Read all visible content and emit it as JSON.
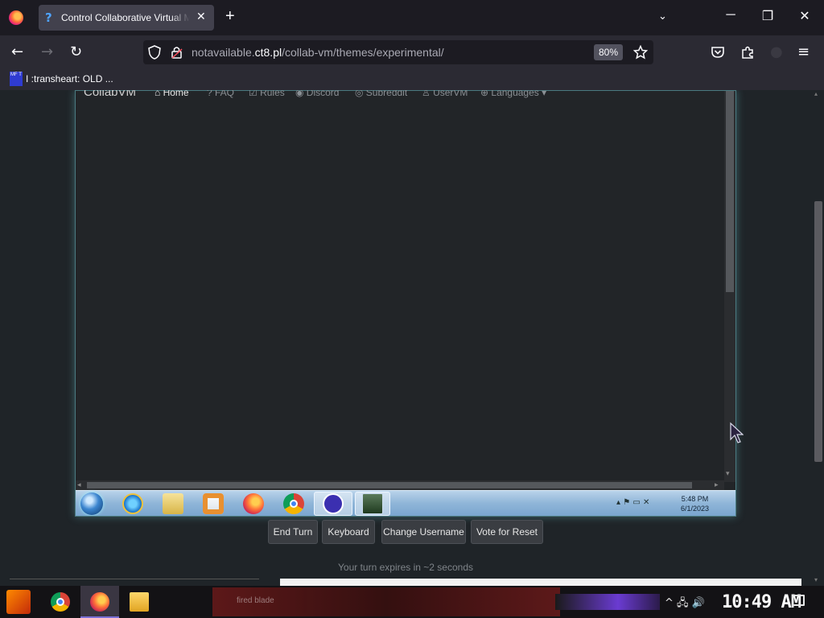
{
  "browser": {
    "tab_title": "Control Collaborative Virtual Machines",
    "tab_favicon": "?",
    "tab_close": "✕",
    "new_tab": "+",
    "tab_list": "⌄",
    "window": {
      "minimize": "─",
      "restore": "❐",
      "close": "✕"
    },
    "nav": {
      "back": "←",
      "forward": "→",
      "reload": "↻"
    },
    "url_prefix": "notavailable.",
    "url_domain": "ct8.pl",
    "url_path": "/collab-vm/themes/experimental/",
    "zoom": "80%",
    "bookmark_icon_text": "MF T",
    "bookmark_label": "I :transheart: OLD ..."
  },
  "site_nav": {
    "brand": "CollabVM",
    "links": [
      {
        "label": "⌂ Home",
        "active": true
      },
      {
        "label": "? FAQ",
        "active": false
      },
      {
        "label": "☑ Rules",
        "active": false
      },
      {
        "label": "◉ Discord",
        "active": false
      },
      {
        "label": "◎ Subreddit",
        "active": false
      },
      {
        "label": "♙ UserVM",
        "active": false
      },
      {
        "label": "⊕ Languages ▾",
        "active": false
      }
    ]
  },
  "vm": {
    "taskbar_icons": [
      "start-orb",
      "internet-explorer-icon",
      "explorer-folder-icon",
      "media-player-icon",
      "firefox-icon",
      "chrome-icon",
      "feather-app-icon",
      "terminal-app-icon"
    ],
    "tray_glyphs": "▴  ⚑  ▭  ✕",
    "clock_time": "5:48 PM",
    "clock_date": "6/1/2023"
  },
  "controls": {
    "end_turn": "End Turn",
    "keyboard": "Keyboard",
    "change_username": "Change Username",
    "vote_reset": "Vote for Reset"
  },
  "status": {
    "turn_text": "Your turn expires in ~2 seconds"
  },
  "host_taskbar": {
    "strip_text": "fired blade",
    "tray_glyphs": "^  🖧  🔊",
    "clock": "10:49 AM"
  },
  "colors": {
    "vm_glow": "#78dce6",
    "host_accent": "#6a3bd1"
  }
}
